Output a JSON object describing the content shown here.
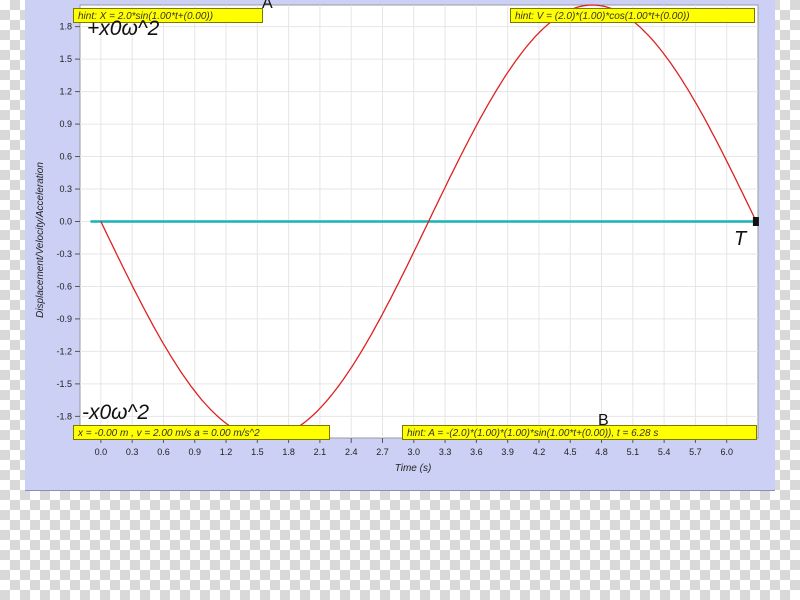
{
  "colors": {
    "panel_bg": "#ccd0f5",
    "plot_bg": "#ffffff",
    "grid": "#e6e6e6",
    "sine": "#dd2222",
    "baseline": "#18b4b4",
    "hint_bg": "#ffff00"
  },
  "labels": {
    "top_amplitude": "+x0ω^2",
    "bottom_amplitude": "-x0ω^2",
    "point_a": "A",
    "point_b": "B",
    "point_t": "T"
  },
  "hints": {
    "top_left": "hint: X = 2.0*sin(1.00*t+(0.00))",
    "top_right": "hint: V = (2.0)*(1.00)*cos(1.00*t+(0.00))",
    "bottom_left": "x = -0.00 m , v = 2.00 m/s a = 0.00 m/s^2",
    "bottom_right": "hint: A = -(2.0)*(1.00)*(1.00)*sin(1.00*t+(0.00)), t = 6.28 s"
  },
  "chart_data": {
    "type": "line",
    "xlabel": "Time (s)",
    "ylabel": "Displacement/Velocity/Acceleration",
    "xlim": [
      -0.2,
      6.3
    ],
    "ylim": [
      -2.0,
      2.0
    ],
    "grid": true,
    "xticks": [
      "0.0",
      "0.3",
      "0.6",
      "0.9",
      "1.2",
      "1.5",
      "1.8",
      "2.1",
      "2.4",
      "2.7",
      "3.0",
      "3.3",
      "3.6",
      "3.9",
      "4.2",
      "4.5",
      "4.8",
      "5.1",
      "5.4",
      "5.7",
      "6.0"
    ],
    "yticks": [
      "1.8",
      "1.5",
      "1.2",
      "0.9",
      "0.6",
      "0.3",
      "0.0",
      "-0.3",
      "-0.6",
      "-0.9",
      "-1.2",
      "-1.5",
      "-1.8"
    ],
    "series": [
      {
        "kind": "function",
        "formula": "-(2.0)*(1.00)*(1.00)*sin(1.00*t+(0.00))",
        "amplitude": 2.0,
        "omega": 1.0,
        "phase": 0.0,
        "t_range": [
          0.0,
          6.28
        ],
        "color": "#dd2222"
      },
      {
        "kind": "constant",
        "value": 0.0,
        "t_range": [
          0.0,
          6.28
        ],
        "color": "#18b4b4"
      }
    ],
    "end_marker": {
      "t": 6.28,
      "value": 0.0
    }
  }
}
